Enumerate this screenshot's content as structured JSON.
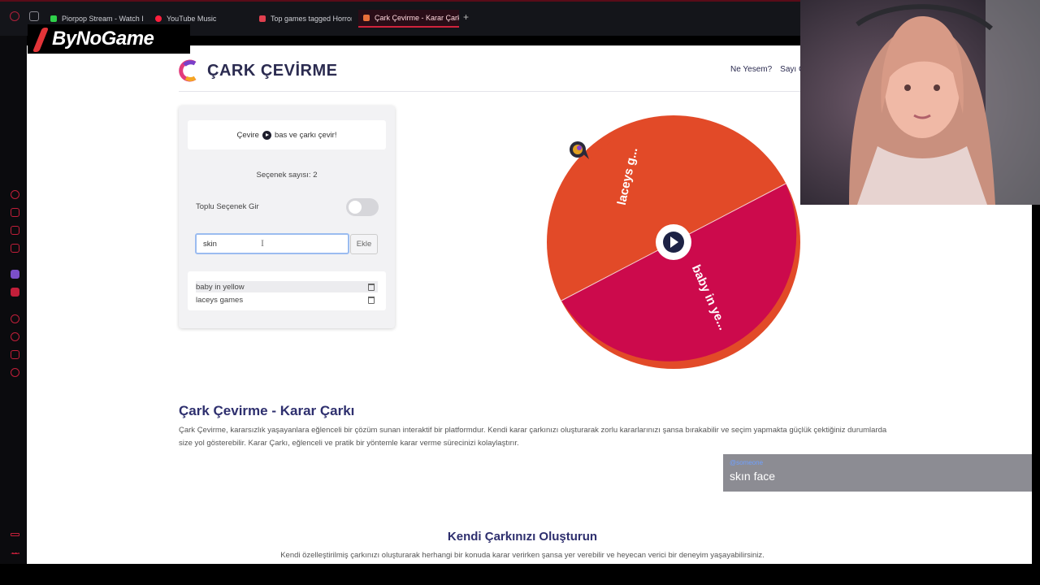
{
  "browser": {
    "tabs": [
      {
        "label": "Piorpop Stream - Watch Li",
        "color": "#2fd04a",
        "active": false
      },
      {
        "label": "YouTube Music",
        "color": "#ff1f3d",
        "active": false
      },
      {
        "label": "Top games tagged Horror",
        "color": "#e0404f",
        "active": false
      },
      {
        "label": "Çark Çevirme - Karar Çark",
        "color": "#e8703a",
        "active": true
      }
    ]
  },
  "overlay": {
    "logo_text": "ByNoGame",
    "chat": {
      "user": "@someone",
      "message": "skın face"
    }
  },
  "site": {
    "title": "ÇARK ÇEVİRME",
    "nav": [
      "Ne Yesem?",
      "Sayı Çarkı"
    ]
  },
  "panel": {
    "hint_before": "Çevire",
    "hint_after": "bas ve çarkı çevir!",
    "option_count": "Seçenek sayısı: 2",
    "bulk_label": "Toplu Seçenek Gir",
    "input_value": "skin",
    "add_label": "Ekle",
    "options": [
      "baby in yellow",
      "laceys games"
    ]
  },
  "wheel": {
    "segments": [
      {
        "label": "laceys g...",
        "color": "#e24a28"
      },
      {
        "label": "baby in ye...",
        "color": "#cc0a4c"
      }
    ]
  },
  "content": {
    "section1_title": "Çark Çevirme - Karar Çarkı",
    "section1_text": "Çark Çevirme, kararsızlık yaşayanlara eğlenceli bir çözüm sunan interaktif bir platformdur. Kendi karar çarkınızı oluşturarak zorlu kararlarınızı şansa bırakabilir ve seçim yapmakta güçlük çektiğiniz durumlarda size yol gösterebilir. Karar Çarkı, eğlenceli ve pratik bir yöntemle karar verme sürecinizi kolaylaştırır.",
    "section2_title": "Kendi Çarkınızı Oluşturun",
    "section2_text": "Kendi özelleştirilmiş çarkınızı oluşturarak herhangi bir konuda karar verirken şansa yer verebilir ve heyecan verici bir deneyim yaşayabilirsiniz."
  }
}
